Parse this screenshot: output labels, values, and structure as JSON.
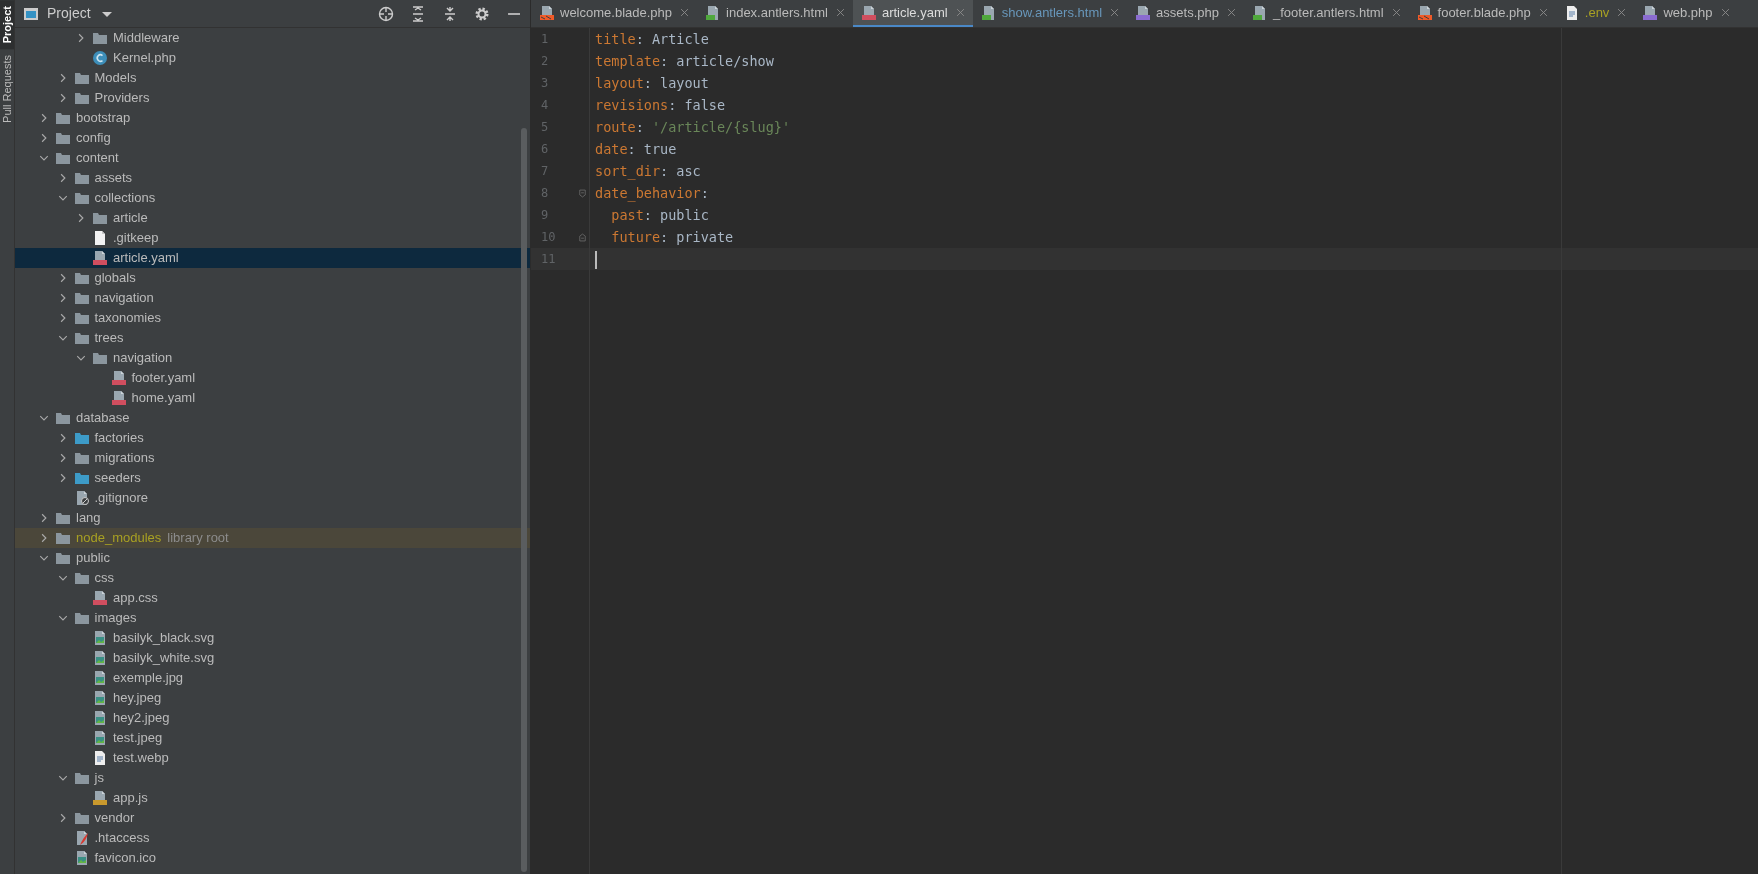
{
  "tool_strip": [
    {
      "label": "Project",
      "selected": true
    },
    {
      "label": "Pull Requests",
      "selected": false
    }
  ],
  "project_panel": {
    "title": "Project"
  },
  "tree": [
    {
      "children": [
        {
          "children": [
            {
              "label": "Middleware",
              "kind": "folder",
              "expanded": false,
              "selected": false
            },
            {
              "label": "Kernel.php",
              "kind": "php-class",
              "selected": false
            }
          ]
        },
        {
          "label": "Models",
          "kind": "folder",
          "expanded": false,
          "selected": false
        },
        {
          "label": "Providers",
          "kind": "folder",
          "expanded": false,
          "selected": false
        }
      ]
    },
    {
      "label": "bootstrap",
      "kind": "folder",
      "expanded": false,
      "selected": false
    },
    {
      "label": "config",
      "kind": "folder",
      "expanded": false,
      "selected": false
    },
    {
      "label": "content",
      "kind": "folder",
      "expanded": true,
      "selected": false,
      "children": [
        {
          "label": "assets",
          "kind": "folder",
          "expanded": false,
          "selected": false
        },
        {
          "label": "collections",
          "kind": "folder",
          "expanded": true,
          "selected": false,
          "children": [
            {
              "label": "article",
              "kind": "folder",
              "expanded": false,
              "selected": false
            },
            {
              "label": ".gitkeep",
              "kind": "text",
              "selected": false
            },
            {
              "label": "article.yaml",
              "kind": "yaml",
              "selected": true
            }
          ]
        },
        {
          "label": "globals",
          "kind": "folder",
          "expanded": false,
          "selected": false
        },
        {
          "label": "navigation",
          "kind": "folder",
          "expanded": false,
          "selected": false
        },
        {
          "label": "taxonomies",
          "kind": "folder",
          "expanded": false,
          "selected": false
        },
        {
          "label": "trees",
          "kind": "folder",
          "expanded": true,
          "selected": false,
          "children": [
            {
              "label": "navigation",
              "kind": "folder",
              "expanded": true,
              "selected": false,
              "children": [
                {
                  "label": "footer.yaml",
                  "kind": "yaml",
                  "selected": false
                },
                {
                  "label": "home.yaml",
                  "kind": "yaml",
                  "selected": false
                }
              ]
            }
          ]
        }
      ]
    },
    {
      "label": "database",
      "kind": "folder",
      "expanded": true,
      "selected": false,
      "children": [
        {
          "label": "factories",
          "kind": "source-folder",
          "expanded": false,
          "selected": false
        },
        {
          "label": "migrations",
          "kind": "folder",
          "expanded": false,
          "selected": false
        },
        {
          "label": "seeders",
          "kind": "source-folder",
          "expanded": false,
          "selected": false
        },
        {
          "label": ".gitignore",
          "kind": "ignore",
          "selected": false
        }
      ]
    },
    {
      "label": "lang",
      "kind": "folder",
      "expanded": false,
      "selected": false
    },
    {
      "label": "node_modules",
      "note": "library root",
      "library": true,
      "kind": "folder",
      "expanded": false,
      "selected": false
    },
    {
      "label": "public",
      "kind": "folder",
      "expanded": true,
      "selected": false,
      "children": [
        {
          "label": "css",
          "kind": "folder",
          "expanded": true,
          "selected": false,
          "children": [
            {
              "label": "app.css",
              "kind": "css",
              "selected": false
            }
          ]
        },
        {
          "label": "images",
          "kind": "folder",
          "expanded": true,
          "selected": false,
          "children": [
            {
              "label": "basilyk_black.svg",
              "kind": "image",
              "selected": false
            },
            {
              "label": "basilyk_white.svg",
              "kind": "image",
              "selected": false
            },
            {
              "label": "exemple.jpg",
              "kind": "image",
              "selected": false
            },
            {
              "label": "hey.jpeg",
              "kind": "image",
              "selected": false
            },
            {
              "label": "hey2.jpeg",
              "kind": "image",
              "selected": false
            },
            {
              "label": "test.jpeg",
              "kind": "image",
              "selected": false
            },
            {
              "label": "test.webp",
              "kind": "text-lines",
              "selected": false
            }
          ]
        },
        {
          "label": "js",
          "kind": "folder",
          "expanded": true,
          "selected": false,
          "children": [
            {
              "label": "app.js",
              "kind": "js",
              "selected": false
            }
          ]
        },
        {
          "label": "vendor",
          "kind": "folder",
          "expanded": false,
          "selected": false
        },
        {
          "label": ".htaccess",
          "kind": "feather",
          "selected": false
        },
        {
          "label": "favicon.ico",
          "kind": "image",
          "selected": false
        }
      ]
    }
  ],
  "tabs": [
    {
      "label": "welcome.blade.php",
      "kind": "blade",
      "modified": false,
      "ignored": false,
      "selected": false
    },
    {
      "label": "index.antlers.html",
      "kind": "html",
      "modified": false,
      "ignored": false,
      "selected": false
    },
    {
      "label": "article.yaml",
      "kind": "yaml",
      "modified": false,
      "ignored": false,
      "selected": true
    },
    {
      "label": "show.antlers.html",
      "kind": "html",
      "modified": true,
      "ignored": false,
      "selected": false
    },
    {
      "label": "assets.php",
      "kind": "php",
      "modified": false,
      "ignored": false,
      "selected": false
    },
    {
      "label": "_footer.antlers.html",
      "kind": "html",
      "modified": false,
      "ignored": false,
      "selected": false
    },
    {
      "label": "footer.blade.php",
      "kind": "blade",
      "modified": false,
      "ignored": false,
      "selected": false
    },
    {
      "label": ".env",
      "kind": "text-lines",
      "modified": false,
      "ignored": true,
      "selected": false
    },
    {
      "label": "web.php",
      "kind": "php",
      "modified": false,
      "ignored": false,
      "selected": false
    }
  ],
  "editor": {
    "lines": [
      {
        "number": "1",
        "indent": false,
        "key": "title",
        "separator": ":",
        "value": "Article",
        "kind": "plain"
      },
      {
        "number": "2",
        "indent": false,
        "key": "template",
        "separator": ":",
        "value": "article/show",
        "kind": "plain"
      },
      {
        "number": "3",
        "indent": false,
        "key": "layout",
        "separator": ":",
        "value": "layout",
        "kind": "plain"
      },
      {
        "number": "4",
        "indent": false,
        "key": "revisions",
        "separator": ":",
        "value": "false",
        "kind": "plain"
      },
      {
        "number": "5",
        "indent": false,
        "key": "route",
        "separator": ":",
        "value": "'/article/{slug}'",
        "kind": "string"
      },
      {
        "number": "6",
        "indent": false,
        "key": "date",
        "separator": ":",
        "value": "true",
        "kind": "plain"
      },
      {
        "number": "7",
        "indent": false,
        "key": "sort_dir",
        "separator": ":",
        "value": "asc",
        "kind": "plain"
      },
      {
        "number": "8",
        "indent": false,
        "key": "date_behavior",
        "separator": ":",
        "fold_start": true
      },
      {
        "number": "9",
        "indent": true,
        "key": "past",
        "separator": ":",
        "value": "public",
        "kind": "plain"
      },
      {
        "number": "10",
        "indent": true,
        "key": "future",
        "separator": ":",
        "value": "private",
        "kind": "plain",
        "fold_end": true
      },
      {
        "number": "11",
        "current": true
      }
    ]
  }
}
